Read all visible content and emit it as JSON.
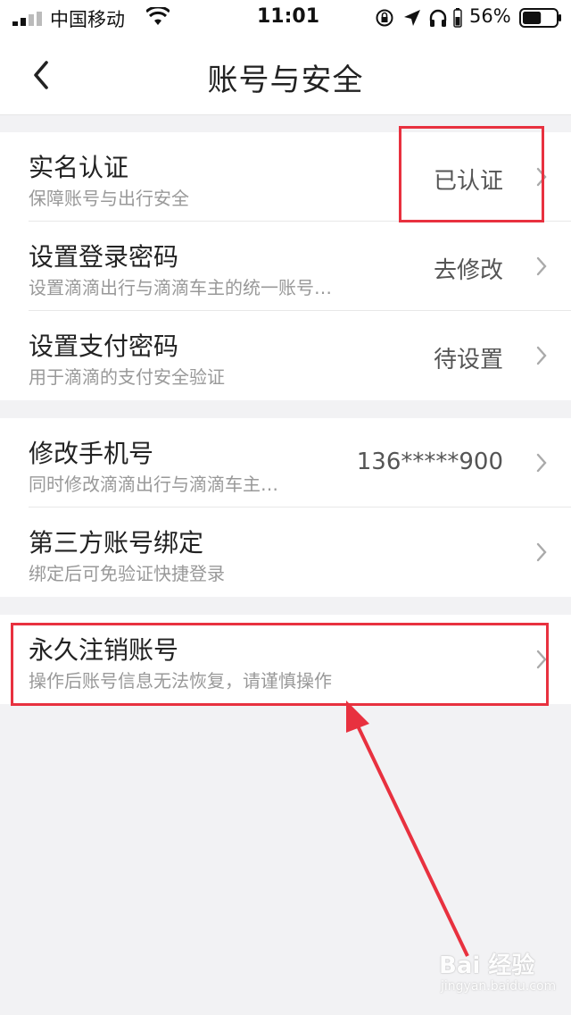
{
  "status_bar": {
    "carrier": "中国移动",
    "time": "11:01",
    "battery_percent": "56%",
    "battery_level": 0.56,
    "icons": [
      "signal-icon",
      "wifi-icon",
      "orientation-lock-icon",
      "location-icon",
      "headphones-icon",
      "battery-icon"
    ]
  },
  "nav": {
    "title": "账号与安全",
    "back_icon": "back-chevron-icon"
  },
  "sections": [
    {
      "rows": [
        {
          "title": "实名认证",
          "subtitle": "保障账号与出行安全",
          "value": "已认证"
        },
        {
          "title": "设置登录密码",
          "subtitle": "设置滴滴出行与滴滴车主的统一账号…",
          "value": "去修改"
        },
        {
          "title": "设置支付密码",
          "subtitle": "用于滴滴的支付安全验证",
          "value": "待设置"
        }
      ]
    },
    {
      "rows": [
        {
          "title": "修改手机号",
          "subtitle": "同时修改滴滴出行与滴滴车主…",
          "value": "136*****900"
        },
        {
          "title": "第三方账号绑定",
          "subtitle": "绑定后可免验证快捷登录",
          "value": ""
        }
      ]
    },
    {
      "rows": [
        {
          "title": "永久注销账号",
          "subtitle": "操作后账号信息无法恢复，请谨慎操作",
          "value": ""
        }
      ]
    }
  ],
  "annotation_color": "#e8313f",
  "watermark": {
    "brand": "Bai 经验",
    "url": "jingyan.baidu.com"
  }
}
